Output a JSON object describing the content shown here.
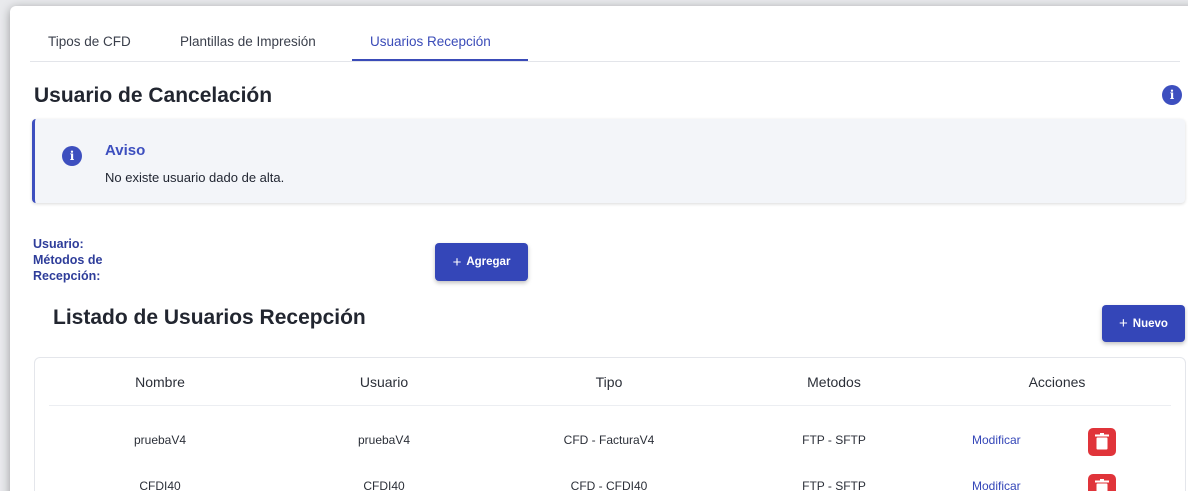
{
  "tabs": [
    {
      "label": "Tipos de CFD",
      "active": false
    },
    {
      "label": "Plantillas de Impresión",
      "active": false
    },
    {
      "label": "Usuarios Recepción",
      "active": true
    }
  ],
  "page_title": "Usuario de Cancelación",
  "alert": {
    "title": "Aviso",
    "message": "No existe usuario dado de alta.",
    "icon": "info-icon"
  },
  "form": {
    "usuario_label": "Usuario:",
    "metodos_label_1": "Métodos de",
    "metodos_label_2": "Recepción:",
    "add_button": "Agregar"
  },
  "list": {
    "title": "Listado de Usuarios Recepción",
    "new_button": "Nuevo",
    "columns": [
      "Nombre",
      "Usuario",
      "Tipo",
      "Metodos",
      "Acciones"
    ],
    "rows": [
      {
        "nombre": "pruebaV4",
        "usuario": "pruebaV4",
        "tipo": "CFD - FacturaV4",
        "metodos": "FTP - SFTP",
        "action": "Modificar"
      },
      {
        "nombre": "CFDI40",
        "usuario": "CFDI40",
        "tipo": "CFD - CFDI40",
        "metodos": "FTP - SFTP",
        "action": "Modificar"
      }
    ]
  },
  "colors": {
    "accent": "#3446b8",
    "danger": "#e0343a",
    "alert_bg": "#f3f5f9"
  }
}
